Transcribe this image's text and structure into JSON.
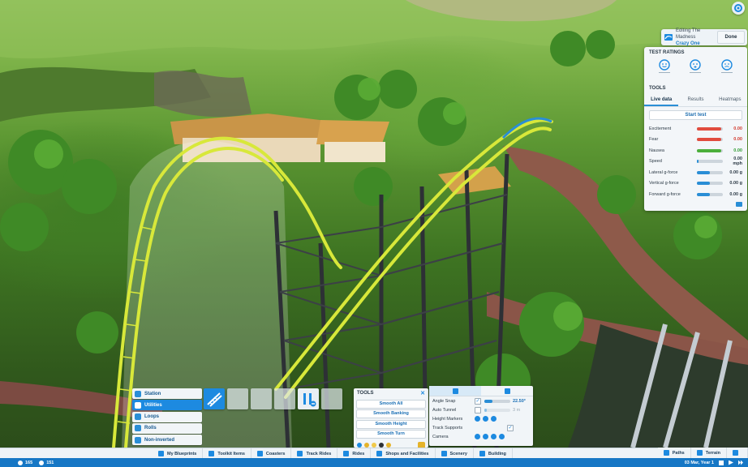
{
  "editing": {
    "label": "Editing The Madness",
    "ride_name": "Crazy One",
    "done_label": "Done"
  },
  "ratings": {
    "title": "TEST RATINGS",
    "faces": [
      "excitement-face",
      "fear-face",
      "nausea-face"
    ],
    "tools_title": "TOOLS",
    "tabs": [
      "Live data",
      "Results",
      "Heatmaps"
    ],
    "active_tab": "Live data",
    "start_label": "Start test",
    "rows": [
      {
        "label": "Excitement",
        "value": "0.00",
        "level": 0.95,
        "bar_color": "#e14c3f",
        "value_color": "#d23a2e"
      },
      {
        "label": "Fear",
        "value": "0.00",
        "level": 0.95,
        "bar_color": "#e14c3f",
        "value_color": "#d23a2e"
      },
      {
        "label": "Nausea",
        "value": "0.00",
        "level": 0.95,
        "bar_color": "#4caf3b",
        "value_color": "#2f9c32"
      },
      {
        "label": "Speed",
        "value": "0.00 mph",
        "level": 0.05,
        "bar_color": "#2a8ed6",
        "value_color": "#2c3a46"
      },
      {
        "label": "Lateral g-force",
        "value": "0.00 g",
        "level": 0.5,
        "bar_color": "#2a8ed6",
        "value_color": "#2c3a46"
      },
      {
        "label": "Vertical g-force",
        "value": "0.00 g",
        "level": 0.5,
        "bar_color": "#2a8ed6",
        "value_color": "#2c3a46"
      },
      {
        "label": "Forward g-force",
        "value": "0.00 g",
        "level": 0.5,
        "bar_color": "#2a8ed6",
        "value_color": "#2c3a46"
      }
    ]
  },
  "type_menu": [
    {
      "label": "Station",
      "active": false
    },
    {
      "label": "Utilities",
      "active": true
    },
    {
      "label": "Loops",
      "active": false
    },
    {
      "label": "Rolls",
      "active": false
    },
    {
      "label": "Non-inverted",
      "active": false
    }
  ],
  "tools": {
    "title": "TOOLS",
    "buttons": [
      "Smooth All",
      "Smooth Banking",
      "Smooth Height",
      "Smooth Turn"
    ]
  },
  "options": {
    "rows": [
      {
        "label": "Angle Snap",
        "checked": true,
        "value": "22.50°",
        "slider_level": 0.3
      },
      {
        "label": "Auto Tunnel",
        "checked": false,
        "value": "3 m",
        "slider_level": 0.1
      },
      {
        "label": "Height Markers"
      },
      {
        "label": "Track Supports",
        "checked": true
      },
      {
        "label": "Camera"
      }
    ]
  },
  "bottom_tabs": [
    "My Blueprints",
    "Toolkit Items",
    "Coasters",
    "Track Rides",
    "Rides",
    "Shops and Facilities",
    "Scenery",
    "Building"
  ],
  "right_tabs": [
    "Paths",
    "Terrain"
  ],
  "status": {
    "guests": "165",
    "money": "151",
    "date": "03 Mar, Year 1"
  },
  "colors": {
    "accent": "#1d8ae0",
    "track": "#d8e83a",
    "status_bar": "#1677c5"
  }
}
